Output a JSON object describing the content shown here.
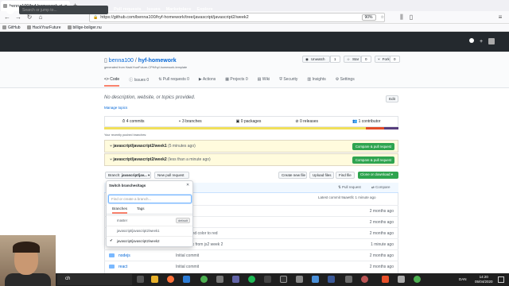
{
  "browser": {
    "tab_title": "benna100/hyf-homework at ja...",
    "url": "https://github.com/benna100/hyf-homework/tree/javascript/javascript2/week2",
    "zoom": "90%",
    "bookmarks": [
      "GitHub",
      "HackYourFuture",
      "billige-boliger.nu"
    ]
  },
  "github": {
    "search_placeholder": "Search or jump to...",
    "nav": [
      "Pull requests",
      "Issues",
      "Marketplace",
      "Explore"
    ]
  },
  "repo": {
    "owner": "benna100",
    "sep": " / ",
    "name": "hyf-homework",
    "generated": "generated from HackYourFuture-CPH/hyf-homework-template",
    "unwatch": "Unwatch",
    "unwatch_count": "1",
    "star": "Star",
    "star_count": "0",
    "fork": "Fork",
    "fork_count": "0",
    "tabs": [
      "Code",
      "Issues",
      "Pull requests",
      "Actions",
      "Projects",
      "Wiki",
      "Security",
      "Insights",
      "Settings"
    ],
    "tab_counts": {
      "issues": "0",
      "pulls": "0",
      "projects": "0"
    },
    "description": "No description, website, or topics provided.",
    "manage_topics": "Manage topics",
    "edit": "Edit",
    "stats": [
      "4 commits",
      "3 branches",
      "0 packages",
      "0 releases",
      "1 contributor"
    ],
    "recent_pushed": "Your recently pushed branches:",
    "pushes": [
      {
        "branch": "javascript/javascript2/week1",
        "when": "(5 minutes ago)",
        "button": "Compare & pull request"
      },
      {
        "branch": "javascript/javascript2/week2",
        "when": "(less than a minute ago)",
        "button": "Compare & pull request"
      }
    ],
    "branch_label": "Branch:",
    "branch_value": "javascript/jav...",
    "new_pr": "New pull request",
    "create_file": "Create new file",
    "upload_files": "Upload files",
    "find_file": "Find file",
    "clone": "Clone or download",
    "pull_request": "Pull request",
    "compare": "Compare",
    "latest_commit": "Latest commit 9aae6fc 1 minute ago"
  },
  "dropdown": {
    "title": "Switch branches/tags",
    "filter_placeholder": "Find or create a branch...",
    "tabs": [
      "Branches",
      "Tags"
    ],
    "items": [
      {
        "name": "master",
        "badge": "default",
        "checked": false
      },
      {
        "name": "javascript/javascript2/week1",
        "badge": "",
        "checked": false
      },
      {
        "name": "javascript/javascript2/week2",
        "badge": "",
        "checked": true
      }
    ]
  },
  "files": [
    {
      "name": "",
      "msg": "ommit",
      "age": "2 months ago"
    },
    {
      "name": "",
      "msg": "ommit",
      "age": "2 months ago"
    },
    {
      "name": "",
      "msg": "background color to red",
      "age": "2 months ago"
    },
    {
      "name": "",
      "msg": "homework from js2 week 2",
      "age": "1 minute ago"
    },
    {
      "name": "nodejs",
      "msg": "Initial commit",
      "age": "2 months ago"
    },
    {
      "name": "react",
      "msg": "Initial commit",
      "age": "2 months ago"
    }
  ],
  "taskbar": {
    "search_text": "ch",
    "lang": "DAN",
    "time": "14:20",
    "date": "05/04/2020"
  },
  "colors": {
    "github_dark": "#24292e",
    "link": "#0366d6",
    "green": "#2ea44f",
    "push_bg": "#fffbdd",
    "lang_bar": [
      "#f1e05a",
      "#e34c26",
      "#563d7c"
    ]
  }
}
